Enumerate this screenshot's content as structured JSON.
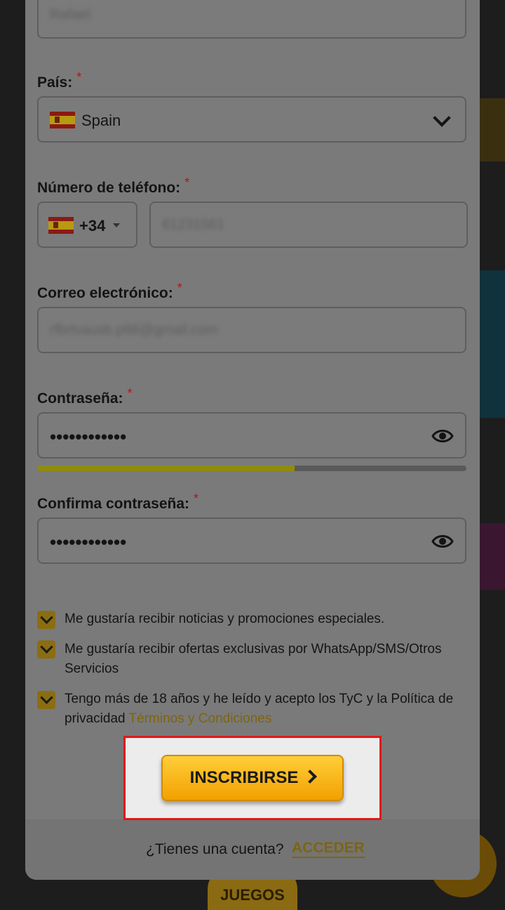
{
  "form": {
    "name_value": "Rafael",
    "country_label": "País:",
    "country_value": "Spain",
    "phone_label": "Número de teléfono:",
    "phone_code": "+34",
    "phone_value": "61231561",
    "email_label": "Correo electrónico:",
    "email_value": "rfbrtvausb.p86@gmail.com",
    "password_label": "Contraseña:",
    "password_value": "••••••••••••",
    "password_strength": 0.6,
    "confirm_label": "Confirma contraseña:",
    "confirm_value": "••••••••••••",
    "required_mark": "*"
  },
  "checkboxes": [
    {
      "text": "Me gustaría recibir noticias y promociones especiales.",
      "checked": true
    },
    {
      "text": "Me gustaría recibir ofertas exclusivas por WhatsApp/SMS/Otros Servicios",
      "checked": true
    },
    {
      "text": "Tengo más de 18 años y he leído y acepto los TyC y la Política de privacidad",
      "link": "Términos y Condiciones",
      "checked": true
    }
  ],
  "cta": {
    "label": "INSCRIBIRSE"
  },
  "footer": {
    "question": "¿Tienes una cuenta?",
    "link": "ACCEDER"
  },
  "background": {
    "nav_label": "JUEGOS"
  },
  "colors": {
    "accent": "#f2a100",
    "link": "#7e6410",
    "required": "#b01818",
    "highlight": "#e01818"
  },
  "icons": [
    "chevron-down-icon",
    "eye-icon",
    "check-icon",
    "chevron-right-icon",
    "flag-spain-icon"
  ]
}
